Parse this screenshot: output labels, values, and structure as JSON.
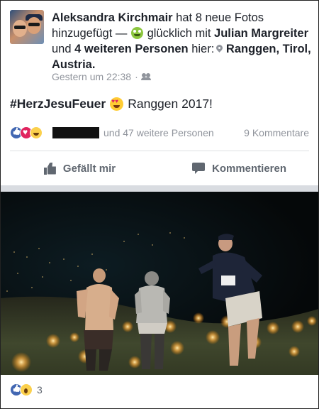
{
  "post": {
    "author": "Aleksandra Kirchmair",
    "action_text": "hat 8 neue Fotos hinzugefügt —",
    "feeling_text": "glücklich mit",
    "tagged_person": "Julian Margreiter",
    "and_text": "und",
    "others_text": "4 weiteren Personen",
    "here_text": "hier:",
    "location": "Ranggen, Tirol, Austria.",
    "timestamp": "Gestern um 22:38",
    "separator": "·",
    "icons": {
      "feeling": "grinning-face-icon",
      "location": "location-pin-icon",
      "audience": "friends-icon"
    }
  },
  "content": {
    "hashtag": "#HerzJesuFeuer",
    "emoji": "heart-eyes-icon",
    "text": "Ranggen 2017!"
  },
  "reactions": {
    "icons": [
      "like-reaction-icon",
      "love-reaction-icon",
      "haha-reaction-icon"
    ],
    "others_text": "und 47 weitere Personen",
    "comments_text": "9 Kommentare"
  },
  "actions": {
    "like_label": "Gefällt mir",
    "comment_label": "Kommentieren"
  },
  "photo_reactions": {
    "icons": [
      "like-reaction-icon",
      "wow-reaction-icon"
    ],
    "count": "3"
  },
  "colors": {
    "brand_blue": "#4267b2",
    "text": "#1d2129",
    "meta_gray": "#90949c",
    "action_gray": "#606770"
  }
}
